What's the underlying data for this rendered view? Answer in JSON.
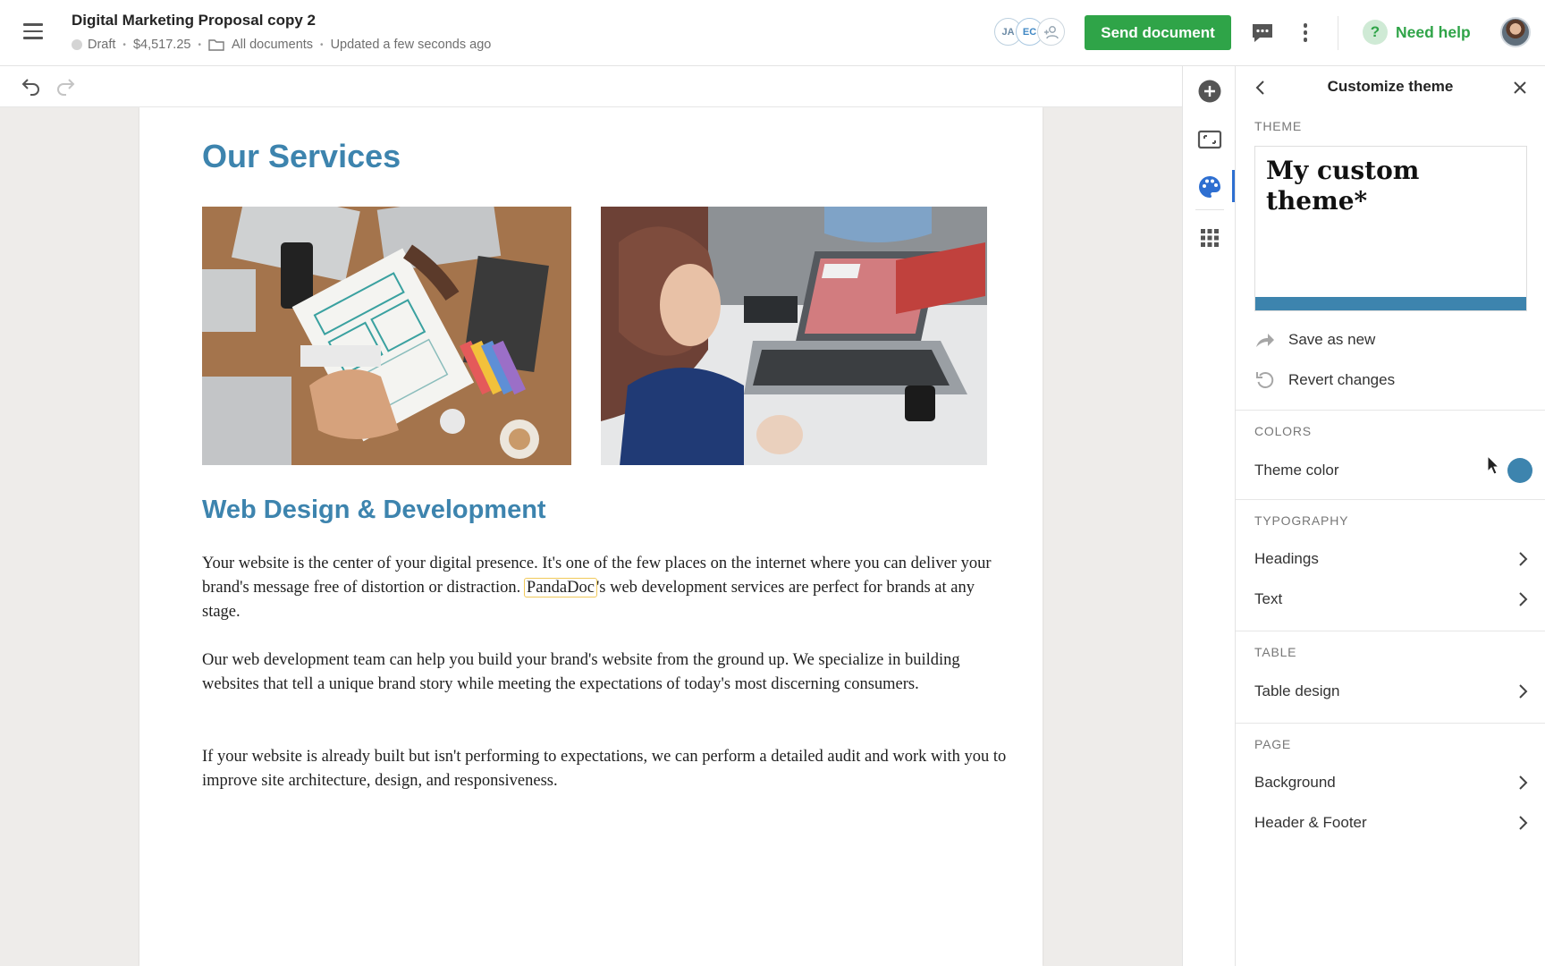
{
  "header": {
    "title": "Digital Marketing Proposal copy 2",
    "status": "Draft",
    "amount": "$4,517.25",
    "folder": "All documents",
    "updated": "Updated a few seconds ago",
    "collaborators": [
      "JA",
      "EC"
    ],
    "send_label": "Send document",
    "help_label": "Need help",
    "help_glyph": "?",
    "accent_color": "#2fa448"
  },
  "document": {
    "heading": "Our Services",
    "subheading": "Web Design & Development",
    "p1_before": "Your website is the center of your digital presence. It's one of the few places on the internet where you can deliver your brand's message free of distortion or distraction.",
    "p1_highlight": "PandaDoc",
    "p1_after": "'s web development services are perfect for brands at any stage.",
    "p2": "Our web development team can help you build your brand's website from the ground up. We specialize in building websites that tell a unique brand story while meeting the expectations of today's most discerning consumers.",
    "p3": "If your website is already built but isn't performing to expectations, we can perform a detailed audit and work with you to improve site architecture, design, and responsiveness.",
    "heading_color": "#3d84ae",
    "images": [
      "office-desk-wireframe-photo",
      "woman-laptop-meeting-photo"
    ]
  },
  "panel": {
    "title": "Customize theme",
    "theme_label": "THEME",
    "theme_name": "My custom theme*",
    "save_as_new": "Save as new",
    "revert_changes": "Revert changes",
    "colors_label": "COLORS",
    "theme_color": "Theme color",
    "theme_color_value": "#3d84ae",
    "typography_label": "TYPOGRAPHY",
    "headings": "Headings",
    "text": "Text",
    "table_label": "TABLE",
    "table_design": "Table design",
    "page_label": "PAGE",
    "background": "Background",
    "header_footer": "Header & Footer"
  },
  "rail": {
    "icons": [
      "add-icon",
      "frame-icon",
      "palette-icon",
      "apps-grid-icon"
    ],
    "active": "palette-icon",
    "active_color": "#2e6fd1"
  }
}
